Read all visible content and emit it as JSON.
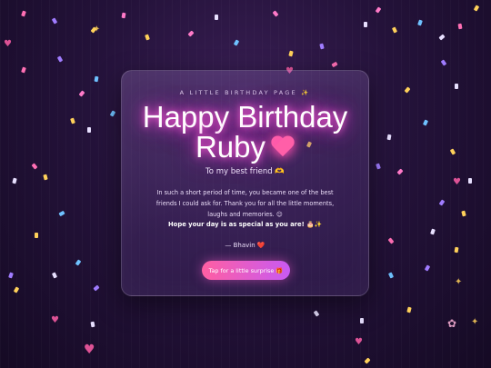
{
  "card": {
    "kicker": "A LITTLE BIRTHDAY PAGE ✨",
    "title_line1": "Happy Birthday",
    "title_line2": "Ruby",
    "subtitle": "To my best friend 🫶",
    "message": "In such a short period of time, you became one of the best friends I could ask for. Thank you for all the little moments, laughs and memories. 😊",
    "wish": "Hope your day is as special as you are! 🎂✨",
    "signature": "— Bhavin ❤️",
    "button_label": "Tap for a little surprise 🎁"
  },
  "colors": {
    "background": "#24123a",
    "title_glow": "#ff5fd6",
    "button_start": "#ff5fa2",
    "button_end": "#c85af2",
    "heart": "#ff5fa8"
  },
  "decorations": {
    "confetti_icon": "confetti-icon",
    "heart_icon": "heart-icon",
    "sparkle_icon": "sparkle-icon",
    "flower_icon": "flower-icon"
  }
}
